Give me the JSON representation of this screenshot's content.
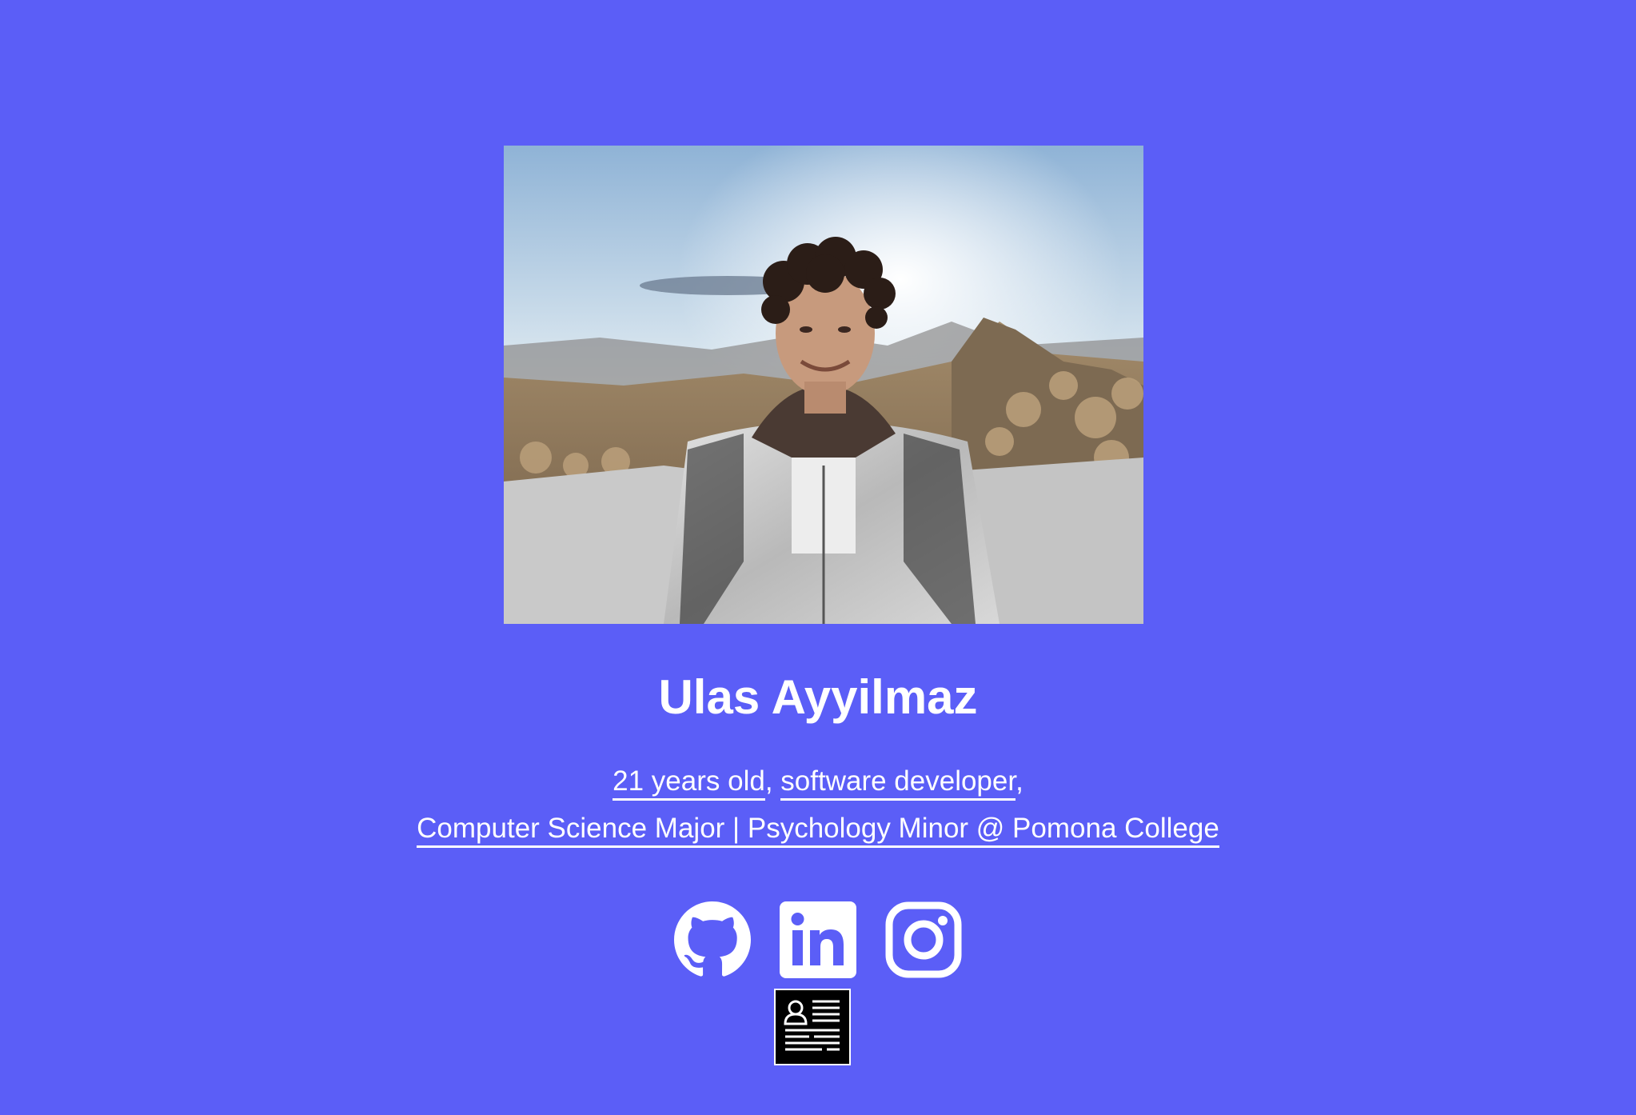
{
  "profile": {
    "name": "Ulas Ayyilmaz",
    "photo_alt": "Selfie on a desert mountain summit",
    "age_link": "21 years old",
    "sep1": ",",
    "role_link": "software developer",
    "sep2": ",",
    "education_link": "Computer Science Major | Psychology Minor @ Pomona College"
  },
  "social": {
    "icons": [
      "github-icon",
      "linkedin-icon",
      "instagram-icon",
      "resume-icon"
    ]
  },
  "colors": {
    "background": "#5b5ef7",
    "text": "#ffffff",
    "resume_icon_bg": "#000000"
  }
}
